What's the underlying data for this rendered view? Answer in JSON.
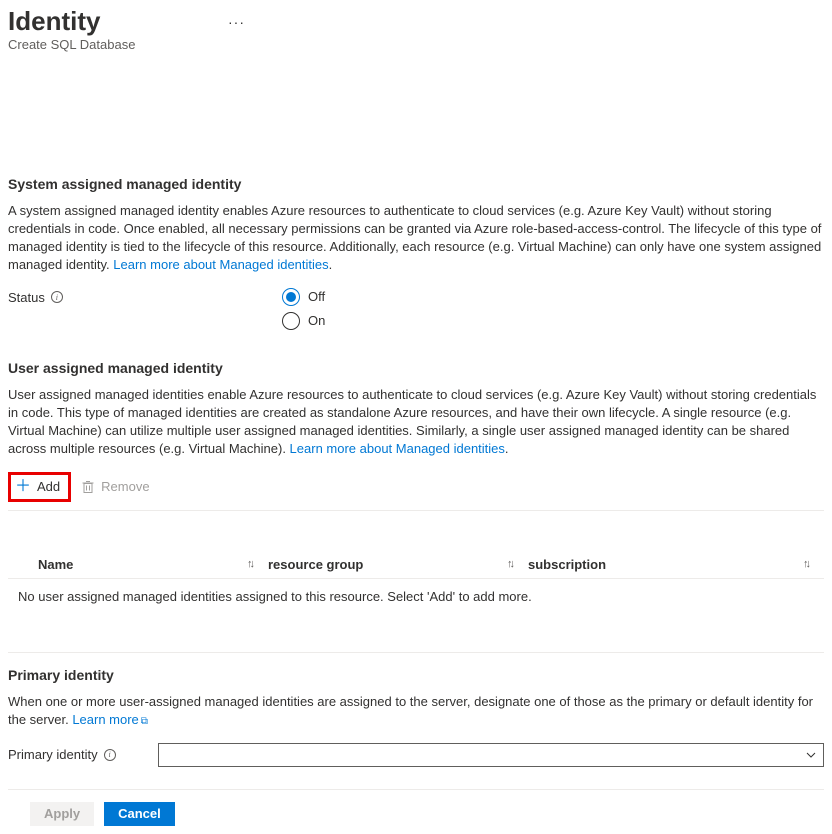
{
  "header": {
    "title": "Identity",
    "subtitle": "Create SQL Database"
  },
  "systemSection": {
    "heading": "System assigned managed identity",
    "description": "A system assigned managed identity enables Azure resources to authenticate to cloud services (e.g. Azure Key Vault) without storing credentials in code. Once enabled, all necessary permissions can be granted via Azure role-based-access-control. The lifecycle of this type of managed identity is tied to the lifecycle of this resource. Additionally, each resource (e.g. Virtual Machine) can only have one system assigned managed identity. ",
    "learnMore": "Learn more about Managed identities",
    "statusLabel": "Status",
    "options": {
      "off": "Off",
      "on": "On"
    },
    "selected": "off"
  },
  "userSection": {
    "heading": "User assigned managed identity",
    "description": "User assigned managed identities enable Azure resources to authenticate to cloud services (e.g. Azure Key Vault) without storing credentials in code. This type of managed identities are created as standalone Azure resources, and have their own lifecycle. A single resource (e.g. Virtual Machine) can utilize multiple user assigned managed identities. Similarly, a single user assigned managed identity can be shared across multiple resources (e.g. Virtual Machine). ",
    "learnMore": "Learn more about Managed identities",
    "toolbar": {
      "add": "Add",
      "remove": "Remove"
    },
    "table": {
      "columns": {
        "name": "Name",
        "resourceGroup": "resource group",
        "subscription": "subscription"
      },
      "emptyMessage": "No user assigned managed identities assigned to this resource. Select 'Add' to add more."
    }
  },
  "primarySection": {
    "heading": "Primary identity",
    "description": "When one or more user-assigned managed identities are assigned to the server, designate one of those as the primary or default identity for the server. ",
    "learnMore": "Learn more",
    "fieldLabel": "Primary identity"
  },
  "footer": {
    "apply": "Apply",
    "cancel": "Cancel"
  }
}
